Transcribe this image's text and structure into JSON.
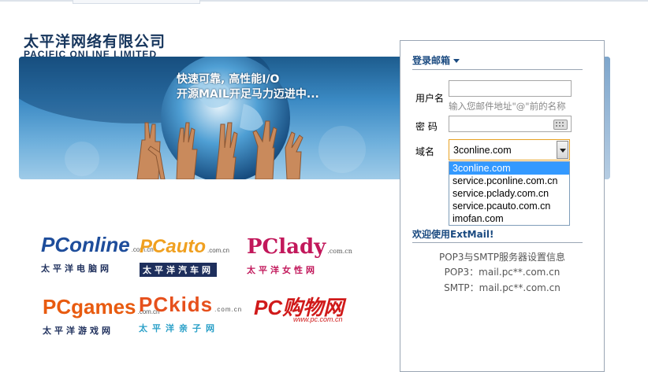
{
  "company": {
    "name_cn": "太平洋网络有限公司",
    "name_en": "PACIFIC ONLINE LIMITED"
  },
  "banner": {
    "slogan_line1": "快速可靠, 高性能I/O",
    "slogan_line2": "开源MAIL开足马力迈进中..."
  },
  "logos": [
    {
      "brand": "PConline",
      "domain": ".com.cn",
      "sub": "太平洋电脑网"
    },
    {
      "brand": "PCauto",
      "domain": ".com.cn",
      "sub": "太平洋汽车网"
    },
    {
      "brand": "PClady",
      "domain": ".com.cn",
      "sub": "太平洋女性网"
    },
    {
      "brand": "PCgames",
      "domain": ".com.cn",
      "sub": "太平洋游戏网"
    },
    {
      "brand": "PCkids",
      "domain": ".com.cn",
      "sub": "太平洋亲子网"
    },
    {
      "brand": "PC购物网",
      "domain": "www.pc.com.cn",
      "sub": ""
    }
  ],
  "login": {
    "header": "登录邮箱",
    "username_label": "用户名",
    "username_value": "",
    "username_hint": "输入您邮件地址\"@\"前的名称",
    "password_label": "密 码",
    "password_value": "",
    "domain_label": "域名",
    "domain_selected": "3conline.com",
    "domain_options": [
      "3conline.com",
      "service.pconline.com.cn",
      "service.pclady.com.cn",
      "service.pcauto.com.cn",
      "imofan.com"
    ],
    "welcome": "欢迎使用ExtMail!",
    "info_title": "POP3与SMTP服务器设置信息",
    "pop3": "POP3：mail.pc**.com.cn",
    "smtp": "SMTP：mail.pc**.com.cn"
  },
  "colors": {
    "brand_blue": "#17365d",
    "link_blue": "#1a4a80",
    "select_highlight": "#3399ff",
    "focus_border": "#e8a224"
  }
}
